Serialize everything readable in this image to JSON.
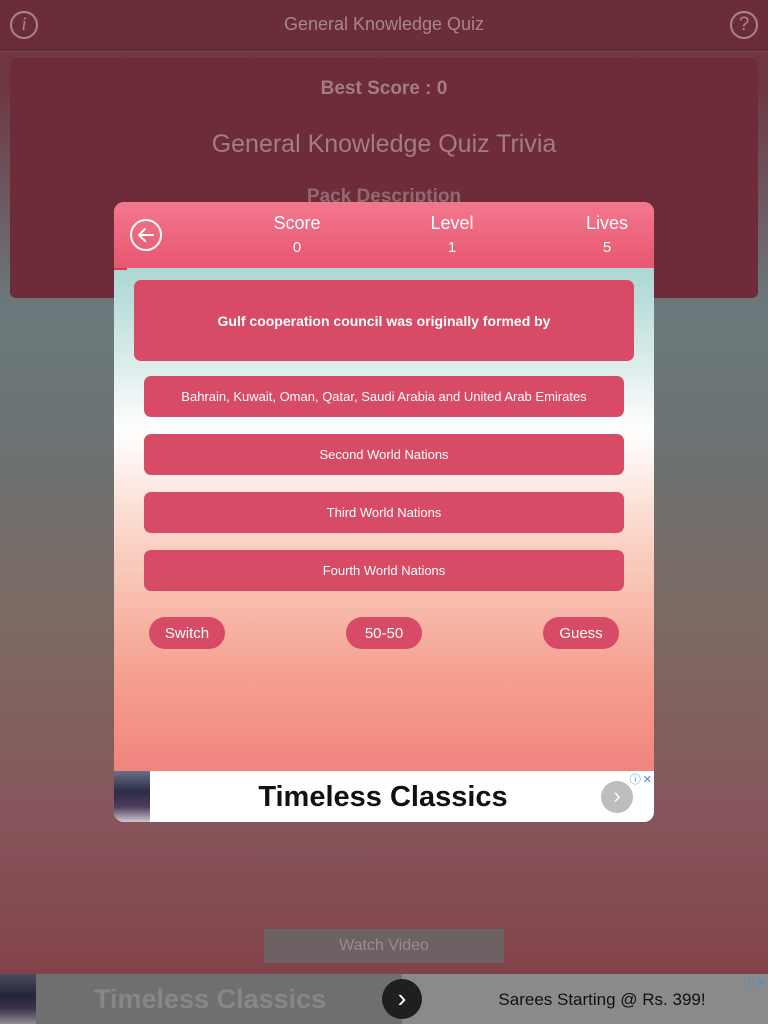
{
  "topbar": {
    "title": "General Knowledge Quiz",
    "info_icon": "info-icon",
    "help_icon": "help-icon",
    "info_glyph": "i",
    "help_glyph": "?"
  },
  "background_card": {
    "best_score": "Best Score : 0",
    "title": "General Knowledge Quiz Trivia",
    "pack_description": "Pack Description"
  },
  "modal": {
    "back_icon": "back-arrow-icon",
    "stats": {
      "score_label": "Score",
      "score_value": "0",
      "level_label": "Level",
      "level_value": "1",
      "lives_label": "Lives",
      "lives_value": "5"
    },
    "question": "Gulf cooperation council was originally formed by",
    "answers": [
      "Bahrain, Kuwait, Oman, Qatar, Saudi Arabia and United Arab Emirates",
      "Second World Nations",
      "Third World Nations",
      "Fourth World Nations"
    ],
    "lifelines": {
      "switch": "Switch",
      "fifty": "50-50",
      "guess": "Guess"
    },
    "ad": {
      "headline": "Timeless Classics",
      "next_glyph": "›",
      "info_glyph": "ⓘ",
      "close_glyph": "✕"
    }
  },
  "watch_video": "Watch Video",
  "banner_ad": {
    "left_text": "Timeless Classics",
    "right_text": "Sarees Starting @ Rs. 399!",
    "next_glyph": "›",
    "info_glyph": "ⓘ",
    "close_glyph": "✕"
  },
  "colors": {
    "header": "#6c2d3b",
    "accent": "#d84b66",
    "modal_header": "#e8566f"
  }
}
